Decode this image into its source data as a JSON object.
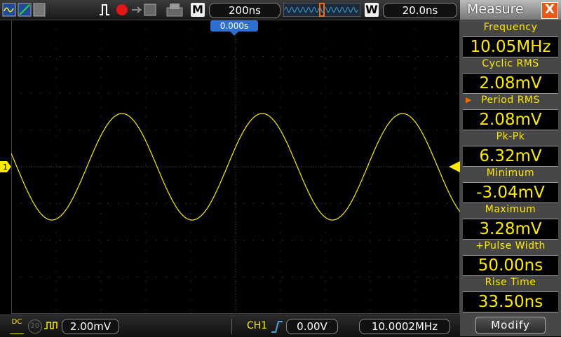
{
  "toolbar": {
    "timebase": "200ns",
    "memory_key": "M",
    "window_key": "W",
    "window_time": "20.0ns"
  },
  "trigger": {
    "position_label": "0.000s"
  },
  "channel": {
    "marker": "1"
  },
  "bottom": {
    "coupling": "DC",
    "bw_limit": "20",
    "volts_div": "2.00mV",
    "trigger_source": "CH1",
    "trigger_level": "0.00V",
    "frequency": "10.0002MHz"
  },
  "measure": {
    "title": "Measure",
    "close": "X",
    "items": [
      {
        "label": "Frequency",
        "value": "10.05MHz"
      },
      {
        "label": "Cyclic RMS",
        "value": "2.08mV"
      },
      {
        "label": "Period RMS",
        "value": "2.08mV",
        "selected": true
      },
      {
        "label": "Pk-Pk",
        "value": "6.32mV"
      },
      {
        "label": "Minimum",
        "value": "-3.04mV"
      },
      {
        "label": "Maximum",
        "value": "3.28mV"
      },
      {
        "label": "+Pulse Width",
        "value": "50.00ns"
      },
      {
        "label": "Rise Time",
        "value": "33.50ns"
      }
    ],
    "modify": "Modify"
  },
  "colors": {
    "trace": "#ffea00",
    "accent": "#ff6a00",
    "trigger_marker": "#3a7fd5",
    "grid": "#555555"
  },
  "waveform": {
    "type": "sine",
    "cycles_visible": 3.2
  }
}
